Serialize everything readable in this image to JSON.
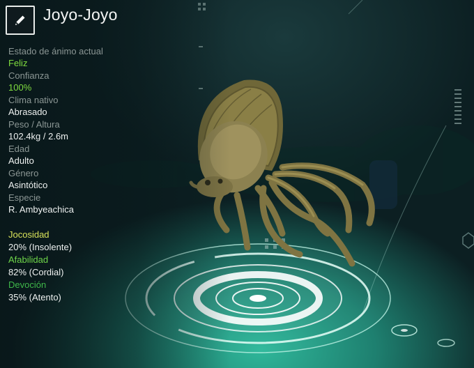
{
  "creature": {
    "name": "Joyo-Joyo"
  },
  "stats": [
    {
      "label": "Estado de ánimo actual",
      "value": "Feliz",
      "highlight": true
    },
    {
      "label": "Confianza",
      "value": "100%",
      "highlight": true
    },
    {
      "label": "Clima nativo",
      "value": "Abrasado",
      "highlight": false
    },
    {
      "label": "Peso / Altura",
      "value": "102.4kg / 2.6m",
      "highlight": false
    },
    {
      "label": "Edad",
      "value": "Adulto",
      "highlight": false
    },
    {
      "label": "Género",
      "value": "Asintótico",
      "highlight": false
    },
    {
      "label": "Especie",
      "value": "R. Ambyeachica",
      "highlight": false
    }
  ],
  "traits": [
    {
      "label": "Jocosidad",
      "value": "20% (Insolente)",
      "color": "#d9e35a"
    },
    {
      "label": "Afabilidad",
      "value": "82% (Cordial)",
      "color": "#6fd64a"
    },
    {
      "label": "Devoción",
      "value": "35% (Atento)",
      "color": "#3fb84a"
    }
  ],
  "icons": {
    "edit": "pencil-icon"
  }
}
